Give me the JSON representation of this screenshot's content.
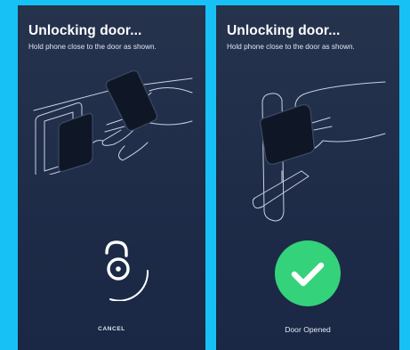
{
  "left_screen": {
    "title": "Unlocking door...",
    "subtitle": "Hold phone close to the door as shown.",
    "cancel_label": "CANCEL",
    "illustration_icon": "phone-near-door-lock-illustration",
    "status_icon": "unlock-padlock-icon"
  },
  "right_screen": {
    "title": "Unlocking door...",
    "subtitle": "Hold phone close to the door as shown.",
    "status_label": "Door Opened",
    "illustration_icon": "phone-near-door-handle-illustration",
    "status_icon": "checkmark-icon"
  },
  "colors": {
    "page_background": "#17c1f5",
    "screen_background": "#1f2c48",
    "success_green": "#34d27a",
    "text_white": "#ffffff"
  }
}
